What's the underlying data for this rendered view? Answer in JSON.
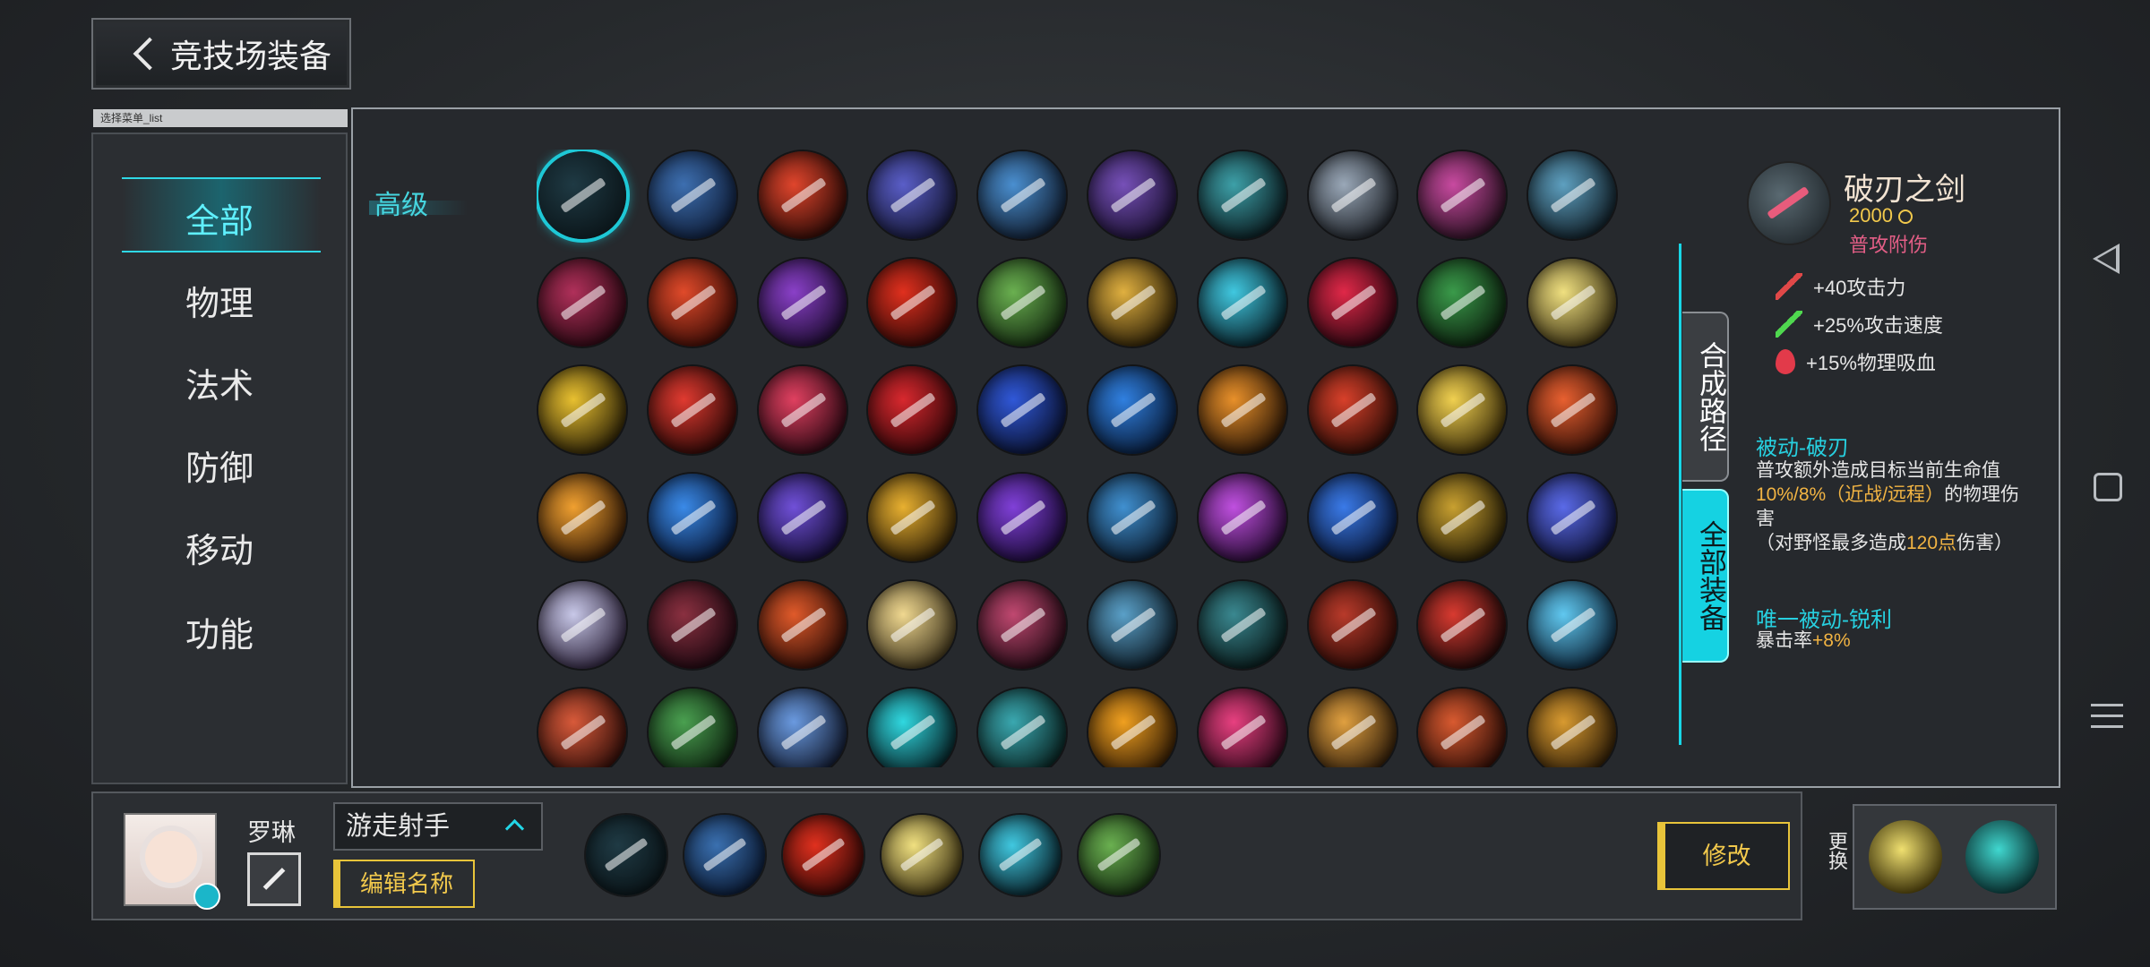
{
  "header": {
    "title": "竞技场装备"
  },
  "sidebar": {
    "caption": "选择菜单_list",
    "categories": [
      {
        "label": "全部",
        "active": true
      },
      {
        "label": "物理"
      },
      {
        "label": "法术"
      },
      {
        "label": "防御"
      },
      {
        "label": "移动"
      },
      {
        "label": "功能"
      }
    ]
  },
  "main": {
    "tier_label": "高级",
    "items": [
      {
        "c1": "#1f3a44",
        "c2": "#0a1418"
      },
      {
        "c1": "#3d6fb0",
        "c2": "#0f1d38"
      },
      {
        "c1": "#e0452c",
        "c2": "#2a0a06"
      },
      {
        "c1": "#5a5ec8",
        "c2": "#141633"
      },
      {
        "c1": "#4a8fd0",
        "c2": "#101c2e"
      },
      {
        "c1": "#7650b8",
        "c2": "#1a1030"
      },
      {
        "c1": "#3da0a8",
        "c2": "#0a1a1e"
      },
      {
        "c1": "#9aa8b8",
        "c2": "#1c2026"
      },
      {
        "c1": "#c84aa0",
        "c2": "#281020"
      },
      {
        "c1": "#5ea0c0",
        "c2": "#0f1c24"
      },
      {
        "c1": "#b0305a",
        "c2": "#2a0812"
      },
      {
        "c1": "#e04a2a",
        "c2": "#3a0c06"
      },
      {
        "c1": "#8a40c8",
        "c2": "#1c0c30"
      },
      {
        "c1": "#e0301e",
        "c2": "#300806"
      },
      {
        "c1": "#6ab050",
        "c2": "#142a10"
      },
      {
        "c1": "#e0b040",
        "c2": "#2a1e06"
      },
      {
        "c1": "#40c8e0",
        "c2": "#082028"
      },
      {
        "c1": "#e02848",
        "c2": "#2a0610"
      },
      {
        "c1": "#3a9a4a",
        "c2": "#0c200e"
      },
      {
        "c1": "#f0e080",
        "c2": "#3a3010"
      },
      {
        "c1": "#e8c030",
        "c2": "#2a2006"
      },
      {
        "c1": "#e03a30",
        "c2": "#2a0806"
      },
      {
        "c1": "#e04060",
        "c2": "#2a0812"
      },
      {
        "c1": "#d8282e",
        "c2": "#300608"
      },
      {
        "c1": "#3058d8",
        "c2": "#0a1230"
      },
      {
        "c1": "#3080e0",
        "c2": "#081a36"
      },
      {
        "c1": "#e8902a",
        "c2": "#2a1606"
      },
      {
        "c1": "#d8402a",
        "c2": "#2a0c06"
      },
      {
        "c1": "#f0d050",
        "c2": "#3a2c08"
      },
      {
        "c1": "#e86030",
        "c2": "#300e06"
      },
      {
        "c1": "#f0a030",
        "c2": "#301806"
      },
      {
        "c1": "#3a8ae8",
        "c2": "#081838"
      },
      {
        "c1": "#7050d8",
        "c2": "#120c30"
      },
      {
        "c1": "#e8b030",
        "c2": "#2c1e06"
      },
      {
        "c1": "#8040d8",
        "c2": "#1a0a36"
      },
      {
        "c1": "#4090d0",
        "c2": "#0a1a2c"
      },
      {
        "c1": "#c050e0",
        "c2": "#240a30"
      },
      {
        "c1": "#3a7ae8",
        "c2": "#081636"
      },
      {
        "c1": "#c8a030",
        "c2": "#241c06"
      },
      {
        "c1": "#5a6ae8",
        "c2": "#0e1236"
      },
      {
        "c1": "#c8c8e8",
        "c2": "#2a2038"
      },
      {
        "c1": "#8a3040",
        "c2": "#1c0810"
      },
      {
        "c1": "#e05a2a",
        "c2": "#2c0c06"
      },
      {
        "c1": "#f0d890",
        "c2": "#3a3018"
      },
      {
        "c1": "#c04870",
        "c2": "#220a14"
      },
      {
        "c1": "#5aa0c8",
        "c2": "#0c1a24"
      },
      {
        "c1": "#3a8890",
        "c2": "#081818"
      },
      {
        "c1": "#b83a2a",
        "c2": "#2a0a06"
      },
      {
        "c1": "#d83a30",
        "c2": "#1a0808"
      },
      {
        "c1": "#60c8f0",
        "c2": "#0c2438"
      },
      {
        "c1": "#d85a3a",
        "c2": "#2c0c08"
      },
      {
        "c1": "#4aa050",
        "c2": "#0c200e"
      },
      {
        "c1": "#6a9ae0",
        "c2": "#10182c"
      },
      {
        "c1": "#30d8e0",
        "c2": "#062024"
      },
      {
        "c1": "#3aa8b0",
        "c2": "#08201e"
      },
      {
        "c1": "#f0a020",
        "c2": "#301a04"
      },
      {
        "c1": "#e84080",
        "c2": "#2c0818"
      },
      {
        "c1": "#e0a040",
        "c2": "#2c1a08"
      },
      {
        "c1": "#d85a30",
        "c2": "#2a0c06"
      },
      {
        "c1": "#d89a30",
        "c2": "#2a1a06"
      }
    ],
    "tabs": {
      "path": "合成路径",
      "all": "全部装备"
    }
  },
  "detail": {
    "name": "破刃之剑",
    "price": "2000",
    "type": "普攻附伤",
    "stats": [
      {
        "icon": "sword-red-icon",
        "text": "+40攻击力"
      },
      {
        "icon": "sword-green-icon",
        "text": "+25%攻击速度"
      },
      {
        "icon": "blood-drop-icon",
        "text": "+15%物理吸血"
      }
    ],
    "passive1": {
      "title": "被动-破刃",
      "t1": "普攻额外造成目标当前生命值",
      "t2": "10%/8%（近战/远程）",
      "t3": "的物理伤害",
      "t4": "（对野怪最多造成",
      "t5": "120点",
      "t6": "伤害）"
    },
    "passive2": {
      "title": "唯一被动-锐利",
      "t1": "暴击率",
      "t2": "+8%"
    }
  },
  "bottom": {
    "hero_name": "罗琳",
    "role": "游走射手",
    "rename_label": "编辑名称",
    "modify_label": "修改",
    "swap_label": "更换",
    "equipped": [
      {
        "c1": "#1f3a44",
        "c2": "#0a1418"
      },
      {
        "c1": "#3a70b0",
        "c2": "#0a1830"
      },
      {
        "c1": "#e0301e",
        "c2": "#300806"
      },
      {
        "c1": "#f0e080",
        "c2": "#3a3010"
      },
      {
        "c1": "#40c8e0",
        "c2": "#082028"
      },
      {
        "c1": "#6ab050",
        "c2": "#142a10"
      }
    ],
    "skills": [
      {
        "c1": "#f0e070",
        "c2": "#3a3008"
      },
      {
        "c1": "#40d8d0",
        "c2": "#082a2a"
      }
    ]
  }
}
